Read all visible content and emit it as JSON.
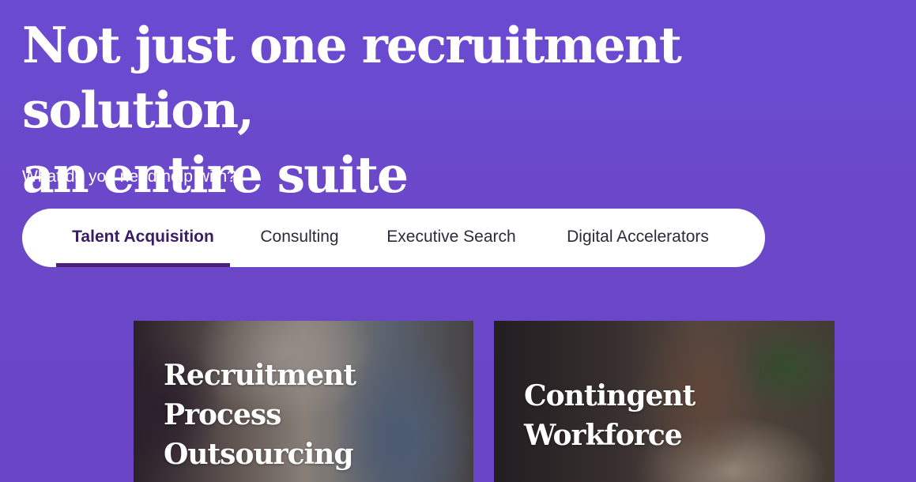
{
  "hero": {
    "title_line1": "Not just one recruitment solution,",
    "title_line2": "an entire suite",
    "prompt": "What do you need help with?"
  },
  "tabs": [
    {
      "label": "Talent Acquisition",
      "active": true
    },
    {
      "label": "Consulting",
      "active": false
    },
    {
      "label": "Executive Search",
      "active": false
    },
    {
      "label": "Digital Accelerators",
      "active": false
    }
  ],
  "cards": [
    {
      "title_lines": [
        "Recruitment",
        "Process",
        "Outsourcing"
      ]
    },
    {
      "title_lines": [
        "Contingent",
        "Workforce"
      ]
    }
  ],
  "colors": {
    "background": "#6a4bd1",
    "tab_active_text": "#3a1c66",
    "tab_active_underline": "#4b1f7a",
    "tab_bar": "#ffffff"
  }
}
